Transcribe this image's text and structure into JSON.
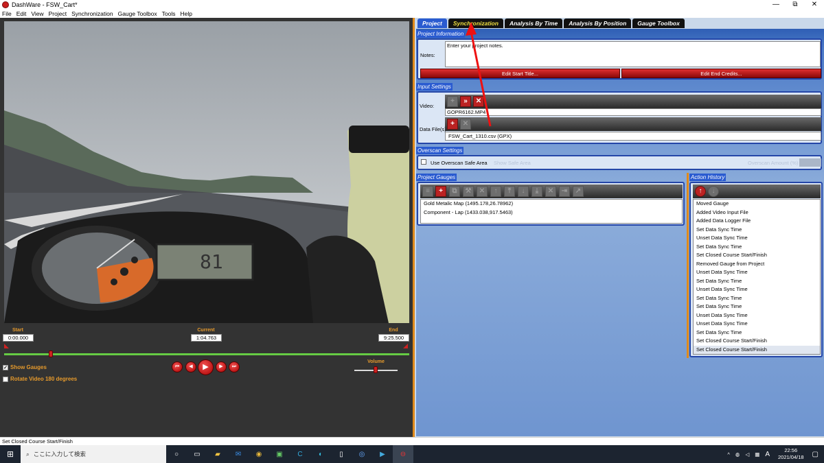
{
  "window": {
    "title": "DashWare - FSW_Cart*",
    "min": "—",
    "max": "⧉",
    "close": "✕"
  },
  "menu": [
    "File",
    "Edit",
    "View",
    "Project",
    "Synchronization",
    "Gauge Toolbox",
    "Tools",
    "Help"
  ],
  "player": {
    "start_label": "Start",
    "start_value": "0:00.000",
    "current_label": "Current",
    "current_value": "1:04.763",
    "end_label": "End",
    "end_value": "9:25.500",
    "volume_label": "Volume",
    "show_gauges": "Show Gauges",
    "show_gauges_checked": true,
    "rotate_video": "Rotate Video 180 degrees",
    "rotate_checked": false
  },
  "tabs": [
    "Project",
    "Synchronization",
    "Analysis By Time",
    "Analysis By Position",
    "Gauge Toolbox"
  ],
  "project_info": {
    "title": "Project Information",
    "notes_label": "Notes:",
    "notes_value": "Enter your project notes.",
    "edit_start": "Edit Start Title...",
    "edit_end": "Edit End Credits..."
  },
  "input_settings": {
    "title": "Input Settings",
    "video_label": "Video:",
    "video_file": "GOPR6162.MP4",
    "data_label": "Data File(s):",
    "data_file": "FSW_Cart_1310.csv (GPX)"
  },
  "overscan": {
    "title": "Overscan Settings",
    "use_label": "Use Overscan Safe Area",
    "show_label": "Show Safe Area",
    "amount_label": "Overscan Amount (%)"
  },
  "project_gauges": {
    "title": "Project Gauges",
    "items": [
      "Gold Metalic Map (1495.178,26.78962)",
      "Component - Lap (1433.038,917.5463)"
    ]
  },
  "action_history": {
    "title": "Action History",
    "items": [
      "Moved Gauge",
      "Added Video Input File",
      "Added Data Logger File",
      "Set Data Sync Time",
      "Unset Data Sync Time",
      "Set Data Sync Time",
      "Set Closed Course Start/Finish",
      "Removed Gauge from Project",
      "Unset Data Sync Time",
      "Set Data Sync Time",
      "Unset Data Sync Time",
      "Set Data Sync Time",
      "Set Data Sync Time",
      "Unset Data Sync Time",
      "Unset Data Sync Time",
      "Set Data Sync Time",
      "Set Closed Course Start/Finish",
      "Set Closed Course Start/Finish"
    ]
  },
  "status": "Set Closed Course Start/Finish",
  "taskbar": {
    "search_placeholder": "ここに入力して検索",
    "time": "22:56",
    "date": "2021/04/18",
    "ime": "A"
  },
  "colors": {
    "accent_orange": "#e69a2c",
    "tab_active": "#2a5bd0",
    "red_button": "#b22222",
    "annotation_arrow": "#ee1111"
  }
}
